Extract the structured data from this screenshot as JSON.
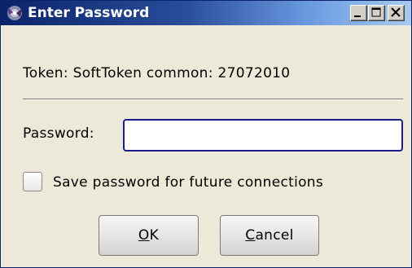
{
  "window": {
    "title": "Enter Password",
    "icon": "app-icon",
    "controls": [
      "minimize-icon",
      "maximize-icon",
      "close-icon"
    ]
  },
  "token": {
    "text": "Token: SoftToken common: 27072010"
  },
  "password": {
    "label": "Password:",
    "value": ""
  },
  "save_option": {
    "label": "Save password for future connections",
    "checked": false
  },
  "buttons": {
    "ok": {
      "mnemonic": "O",
      "rest": "K"
    },
    "cancel": {
      "mnemonic": "C",
      "rest": "ancel"
    }
  },
  "colors": {
    "title_bar_start": "#0a246a",
    "title_bar_end": "#a6caf0",
    "window_bg": "#ece9d8",
    "input_border": "#1c1c8a"
  }
}
